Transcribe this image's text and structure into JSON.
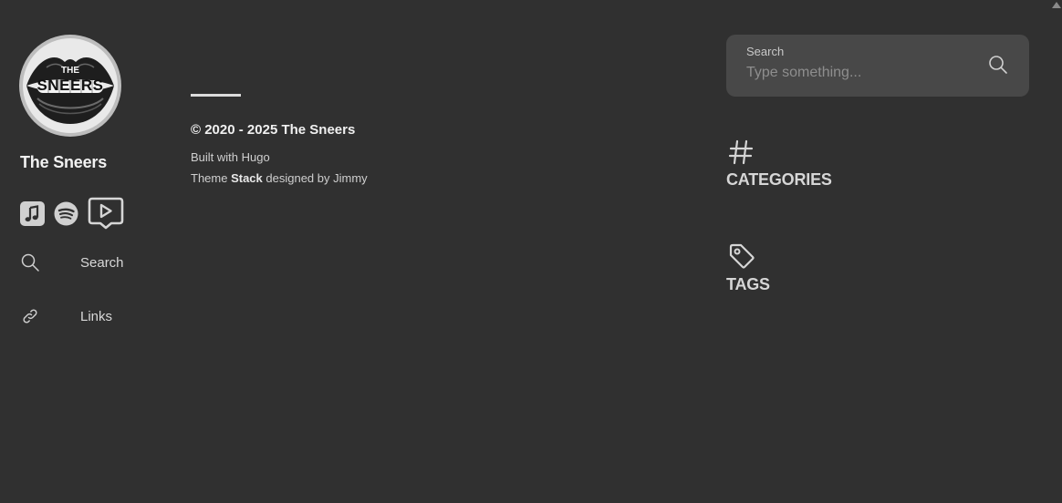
{
  "site": {
    "name": "The Sneers",
    "avatar_text_top": "THE",
    "avatar_text_main": "SNEERS"
  },
  "social": [
    {
      "name": "apple-music-icon"
    },
    {
      "name": "spotify-icon"
    },
    {
      "name": "video-icon"
    }
  ],
  "menu": {
    "search_label": "Search",
    "links_label": "Links"
  },
  "footer": {
    "copyright": "© 2020 - 2025 The Sneers",
    "built_with": "Built with Hugo",
    "theme_prefix": "Theme ",
    "theme_name": "Stack",
    "theme_suffix": " designed by Jimmy"
  },
  "search": {
    "label": "Search",
    "placeholder": "Type something..."
  },
  "widgets": {
    "categories_title": "CATEGORIES",
    "tags_title": "TAGS"
  },
  "colors": {
    "background": "#303030",
    "search_box": "#484848",
    "text": "#e8e8e8"
  }
}
